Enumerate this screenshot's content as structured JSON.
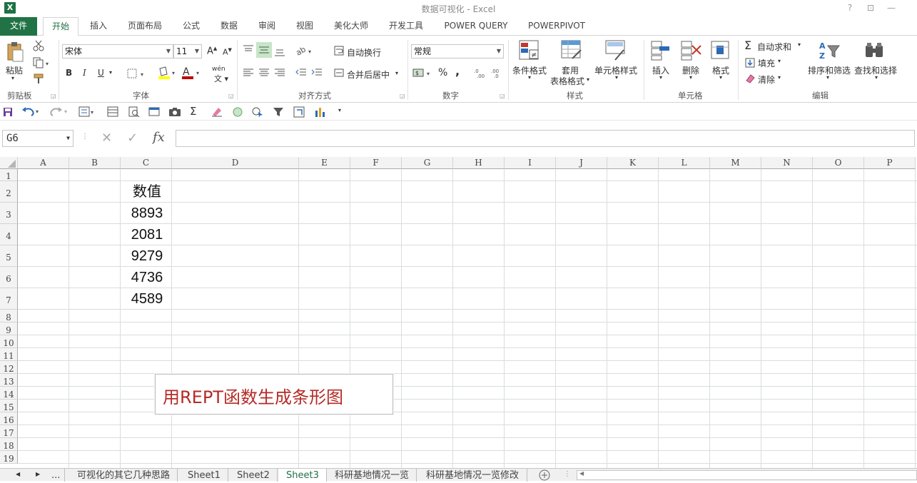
{
  "window": {
    "title": "数据可视化 - Excel",
    "help": "?",
    "restore": "⊡",
    "minimize": "—"
  },
  "ribbon_tabs": [
    "文件",
    "开始",
    "插入",
    "页面布局",
    "公式",
    "数据",
    "审阅",
    "视图",
    "美化大师",
    "开发工具",
    "POWER QUERY",
    "POWERPIVOT"
  ],
  "clipboard": {
    "paste": "粘贴",
    "group": "剪贴板"
  },
  "font": {
    "name": "宋体",
    "size": "11",
    "bold": "B",
    "italic": "I",
    "underline": "U",
    "grow": "A",
    "shrink": "A",
    "group": "字体",
    "wen": "wén"
  },
  "alignment": {
    "wrap": "自动换行",
    "merge": "合并后居中",
    "group": "对齐方式"
  },
  "number": {
    "format": "常规",
    "percent": "%",
    "comma": ",",
    "group": "数字"
  },
  "styles": {
    "conditional": "条件格式",
    "table1": "套用",
    "table2": "表格格式",
    "cellstyle": "单元格样式",
    "group": "样式"
  },
  "cells": {
    "insert": "插入",
    "delete": "删除",
    "format": "格式",
    "group": "单元格"
  },
  "editing": {
    "autosum": "自动求和",
    "fill": "填充",
    "clear": "清除",
    "sort": "排序和筛选",
    "find": "查找和选择",
    "group": "编辑"
  },
  "formula_bar": {
    "namebox": "G6",
    "fx": "fx",
    "value": ""
  },
  "columns": [
    "A",
    "B",
    "C",
    "D",
    "E",
    "F",
    "G",
    "H",
    "I",
    "J",
    "K",
    "L",
    "M",
    "N",
    "O",
    "P"
  ],
  "rows": [
    "1",
    "2",
    "3",
    "4",
    "5",
    "6",
    "7",
    "8",
    "9",
    "10",
    "11",
    "12",
    "13",
    "14",
    "15",
    "16",
    "17",
    "18",
    "19"
  ],
  "cells_data": {
    "C2": "数值",
    "C3": "8893",
    "C4": "2081",
    "C5": "9279",
    "C6": "4736",
    "C7": "4589"
  },
  "textbox": {
    "text": "用REPT函数生成条形图"
  },
  "sheet_tabs": [
    "...",
    "可视化的其它几种思路",
    "Sheet1",
    "Sheet2",
    "Sheet3",
    "科研基地情况一览",
    "科研基地情况一览修改"
  ],
  "active_sheet": "Sheet3",
  "colors": {
    "excel_green": "#217346",
    "textbox_text": "#b52b27"
  }
}
